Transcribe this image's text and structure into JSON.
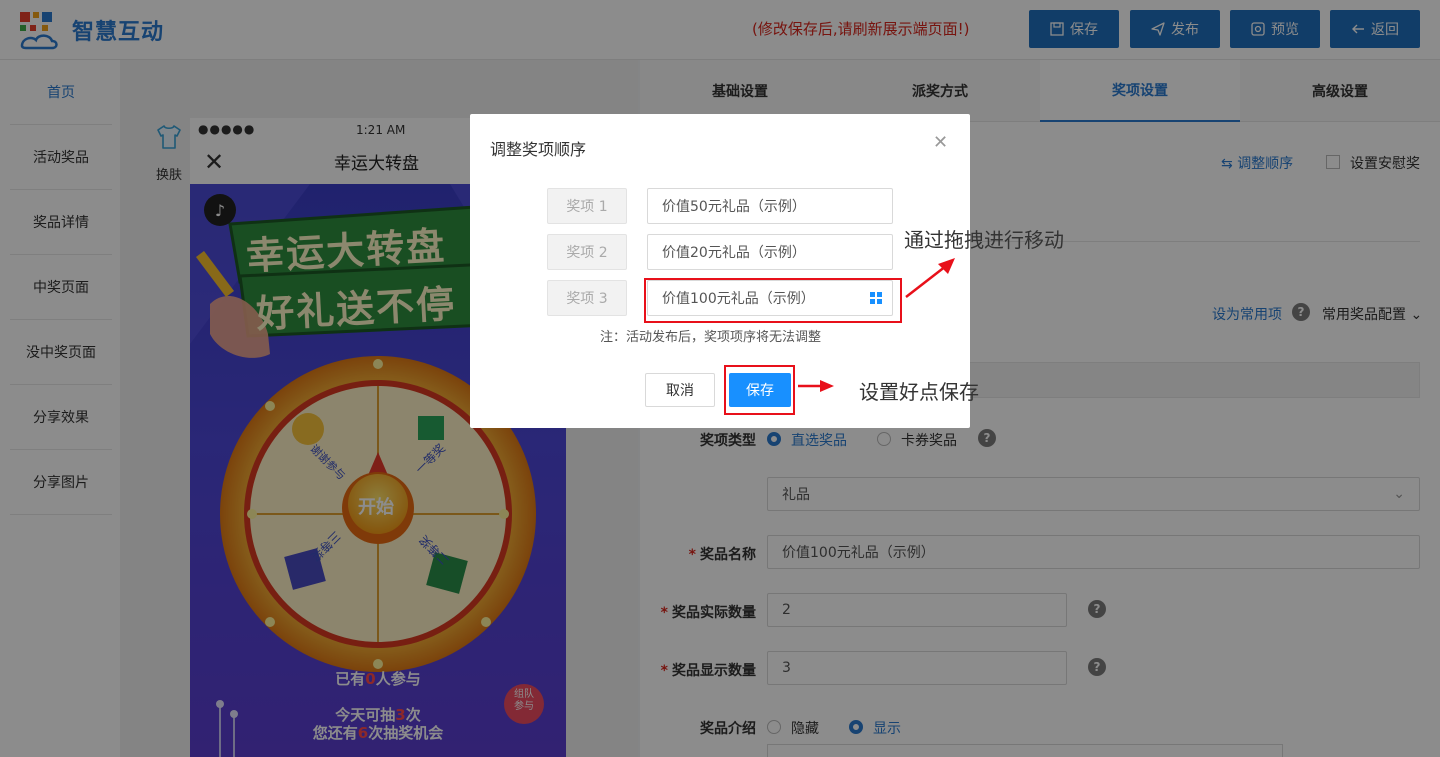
{
  "header": {
    "brand": "智慧互动",
    "notice": "(修改保存后,请刷新展示端页面!)",
    "buttons": {
      "save": "保存",
      "publish": "发布",
      "preview": "预览",
      "back": "返回"
    }
  },
  "sidebar": {
    "items": [
      {
        "label": "首页",
        "active": true
      },
      {
        "label": "活动奖品"
      },
      {
        "label": "奖品详情"
      },
      {
        "label": "中奖页面"
      },
      {
        "label": "没中奖页面"
      },
      {
        "label": "分享效果"
      },
      {
        "label": "分享图片"
      }
    ]
  },
  "preview": {
    "skin_label": "换肤",
    "status_dots": "●●●●●",
    "status_time": "1:21 AM",
    "page_title": "幸运大转盘",
    "poster_title_1": "幸运大转盘",
    "poster_title_2": "好礼送不停",
    "wheel_center": "开始",
    "prizes": [
      "谢谢参与",
      "一等奖",
      "二等奖",
      "三等奖"
    ],
    "participants_prefix": "已有",
    "participants_count": "0",
    "participants_suffix": "人参与",
    "today_prefix": "今天可抽",
    "today_count": "3",
    "today_suffix": "次",
    "remain_prefix": "您还有",
    "remain_count": "6",
    "remain_suffix": "次抽奖机会",
    "team_badge": "组队参与"
  },
  "tabs": [
    {
      "label": "基础设置"
    },
    {
      "label": "派奖方式"
    },
    {
      "label": "奖项设置",
      "active": true
    },
    {
      "label": "高级设置"
    }
  ],
  "form": {
    "adjust_order_link": "调整顺序",
    "consolation_label": "设置安慰奖",
    "common_link": "设为常用项",
    "common_config": "常用奖品配置",
    "prize_type_label": "奖项类型",
    "prize_type_options": [
      "直选奖品",
      "卡券奖品"
    ],
    "gift_select": "礼品",
    "prize_name_label": "奖品名称",
    "prize_name_value": "价值100元礼品（示例）",
    "actual_qty_label": "奖品实际数量",
    "actual_qty_value": "2",
    "display_qty_label": "奖品显示数量",
    "display_qty_value": "3",
    "intro_label": "奖品介绍",
    "intro_options": [
      "隐藏",
      "显示"
    ]
  },
  "modal": {
    "title": "调整奖项顺序",
    "rows": [
      {
        "label": "奖项 1",
        "value": "价值50元礼品（示例）"
      },
      {
        "label": "奖项 2",
        "value": "价值20元礼品（示例）"
      },
      {
        "label": "奖项 3",
        "value": "价值100元礼品（示例）"
      }
    ],
    "note": "注：活动发布后，奖项项序将无法调整",
    "cancel": "取消",
    "save": "保存"
  },
  "annotations": {
    "drag": "通过拖拽进行移动",
    "save": "设置好点保存"
  },
  "colors": {
    "primary": "#1f6fbd",
    "accent": "#2a7ad0",
    "danger": "#e8101a",
    "modal_save": "#1890ff"
  }
}
